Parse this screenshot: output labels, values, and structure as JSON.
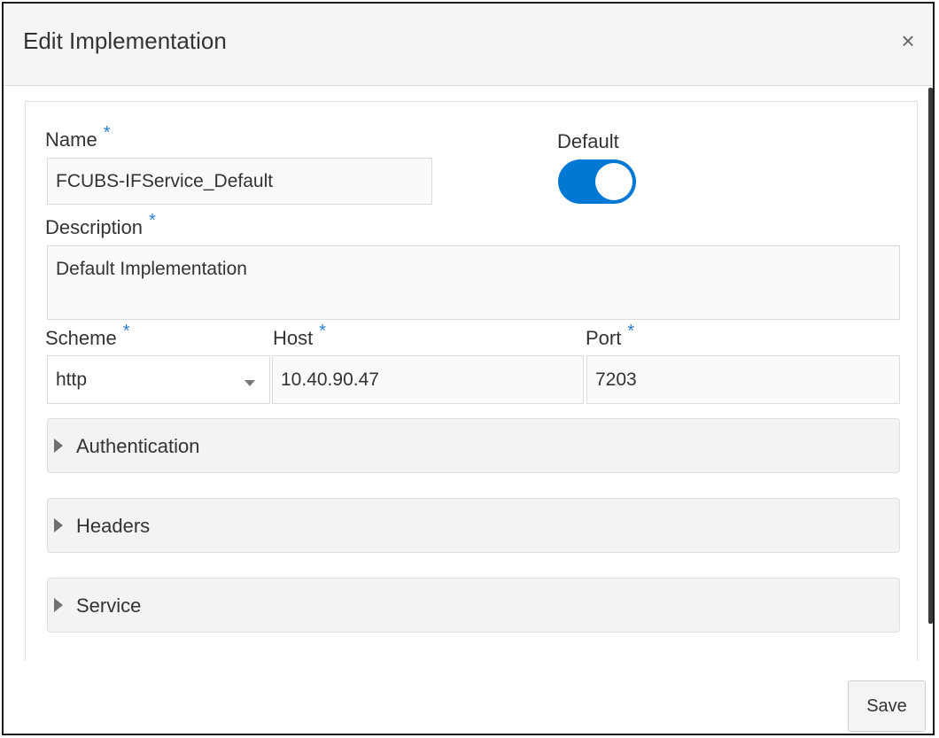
{
  "dialog": {
    "title": "Edit Implementation",
    "close_glyph": "×",
    "save_label": "Save"
  },
  "form": {
    "required_marker": "*",
    "name": {
      "label": "Name",
      "value": "FCUBS-IFService_Default"
    },
    "default": {
      "label": "Default",
      "checked": true,
      "on_color": "#0078d4"
    },
    "description": {
      "label": "Description",
      "value": "Default Implementation"
    },
    "scheme": {
      "label": "Scheme",
      "value": "http"
    },
    "host": {
      "label": "Host",
      "value": "10.40.90.47"
    },
    "port": {
      "label": "Port",
      "value": "7203"
    }
  },
  "sections": [
    {
      "label": "Authentication",
      "expanded": false
    },
    {
      "label": "Headers",
      "expanded": false
    },
    {
      "label": "Service",
      "expanded": false
    }
  ],
  "icons": {
    "close": "close-icon",
    "dropdown": "chevron-down-icon",
    "collapsed": "caret-right-icon"
  }
}
